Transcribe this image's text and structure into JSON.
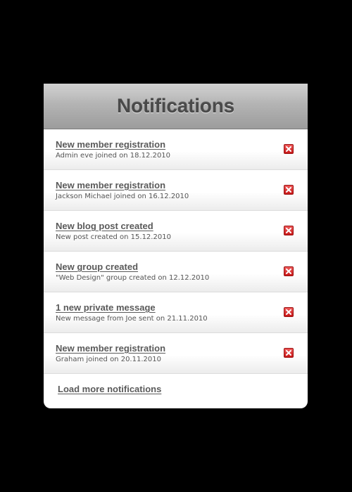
{
  "panel": {
    "title": "Notifications"
  },
  "notifications": [
    {
      "title": "New member registration",
      "description": "Admin eve joined on 18.12.2010"
    },
    {
      "title": "New member registration",
      "description": "Jackson Michael joined on 16.12.2010"
    },
    {
      "title": "New blog post created",
      "description": "New post created on 15.12.2010"
    },
    {
      "title": "New group created",
      "description": "\"Web Design\" group created on 12.12.2010"
    },
    {
      "title": "1 new private message",
      "description": "New message from Joe sent on 21.11.2010"
    },
    {
      "title": "New member registration",
      "description": "Graham joined on 20.11.2010"
    }
  ],
  "footer": {
    "load_more_label": "Load more notifications"
  },
  "icons": {
    "dismiss": "close-icon"
  },
  "colors": {
    "background": "#000000",
    "panel": "#ffffff",
    "header_gradient_top": "#d2d2d2",
    "header_gradient_bottom": "#9c9c9c",
    "title_text": "#4a4a4a",
    "link_text": "#5a5a5a",
    "dismiss_red": "#c71818"
  }
}
